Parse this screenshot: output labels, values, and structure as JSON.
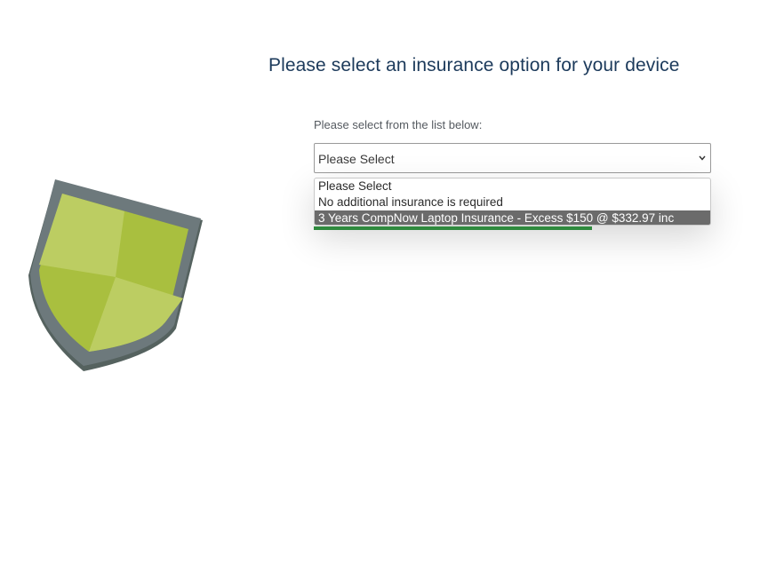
{
  "header": {
    "title": "Please select an insurance option for your device"
  },
  "form": {
    "instruction": "Please select from the list below:",
    "select": {
      "selected_value": "Please Select",
      "chevron_icon": "chevron-down-icon",
      "options": [
        "Please Select",
        "No additional insurance is required",
        "3 Years CompNow Laptop Insurance - Excess $150 @ $332.97 inc"
      ],
      "highlighted_index": 2
    }
  },
  "progress": {
    "fraction": 0.7,
    "color": "#2f8a3e"
  },
  "illustration": {
    "icon": "shield-icon",
    "colors": {
      "frame": "#6a767a",
      "green_light": "#b9cc5d",
      "green_dark": "#a6bd3c"
    }
  }
}
